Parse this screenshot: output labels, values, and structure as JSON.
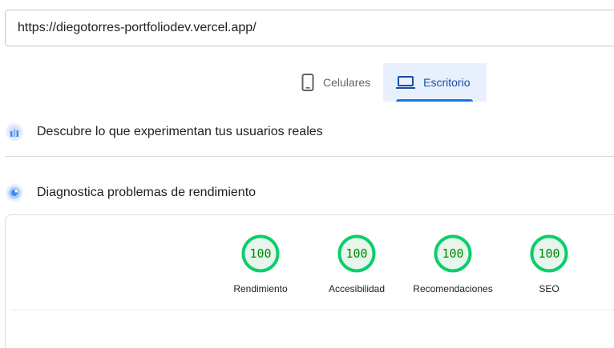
{
  "url_input": {
    "value": "https://diegotorres-portfoliodev.vercel.app/"
  },
  "device_tabs": [
    {
      "label": "Celulares",
      "icon": "smartphone-icon",
      "active": false
    },
    {
      "label": "Escritorio",
      "icon": "laptop-icon",
      "active": true
    }
  ],
  "sections": {
    "crux": {
      "title": "Descubre lo que experimentan tus usuarios reales",
      "icon": "user-experience-icon"
    },
    "lab": {
      "title": "Diagnostica problemas de rendimiento",
      "icon": "lab-diagnostics-icon"
    }
  },
  "scores": [
    {
      "label": "Rendimiento",
      "value": "100"
    },
    {
      "label": "Accesibilidad",
      "value": "100"
    },
    {
      "label": "Recomendaciones",
      "value": "100"
    },
    {
      "label": "SEO",
      "value": "100"
    }
  ],
  "colors": {
    "pass_green": "#0cce6b",
    "pass_fill": "#e6f6ec",
    "score_text": "#008800",
    "accent_blue": "#1a73e8",
    "active_tab_bg": "#e8f0fe"
  }
}
